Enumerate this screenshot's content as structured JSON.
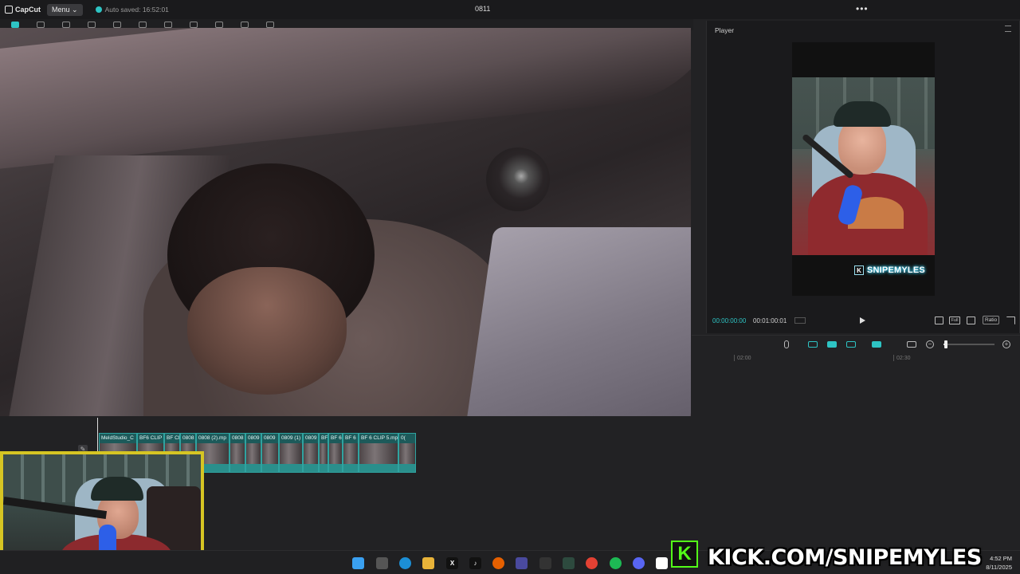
{
  "app": {
    "logo_text": "CapCut",
    "menu_label": "Menu ⌄",
    "autosave_text": "Auto saved: 16:52:01",
    "project_title": "0811",
    "more_label": "•••"
  },
  "player": {
    "title": "Player",
    "time_current": "00:00:00:00",
    "time_total": "00:01:00:01",
    "full_label": "Full",
    "ratio_label": "Ratio",
    "watermark_text": "SNIPEMYLES",
    "watermark_badge": "K"
  },
  "timeline": {
    "ruler": [
      "02:00",
      "02:30"
    ],
    "zoom_level": 0.05,
    "clips": [
      {
        "label": "MeldStudio_C"
      },
      {
        "label": "BF6 CLIP"
      },
      {
        "label": "BF Cl"
      },
      {
        "label": "0808"
      },
      {
        "label": "0808 (2).mp"
      },
      {
        "label": "0808"
      },
      {
        "label": "0809"
      },
      {
        "label": "0809"
      },
      {
        "label": "0809 (1)"
      },
      {
        "label": "0809"
      },
      {
        "label": "BF"
      },
      {
        "label": "BF 6"
      },
      {
        "label": "BF 6"
      },
      {
        "label": "BF 6 CLIP 5.mp4"
      },
      {
        "label": "0("
      }
    ]
  },
  "taskbar": {
    "time": "4:52 PM",
    "date": "8/11/2025"
  },
  "overlay": {
    "kick_logo": "K",
    "kick_banner": "KICK.COM/SNIPEMYLES"
  },
  "colors": {
    "accent": "#2ec4c4",
    "kick_green": "#53fc18",
    "webcam_border": "#d6c523"
  }
}
